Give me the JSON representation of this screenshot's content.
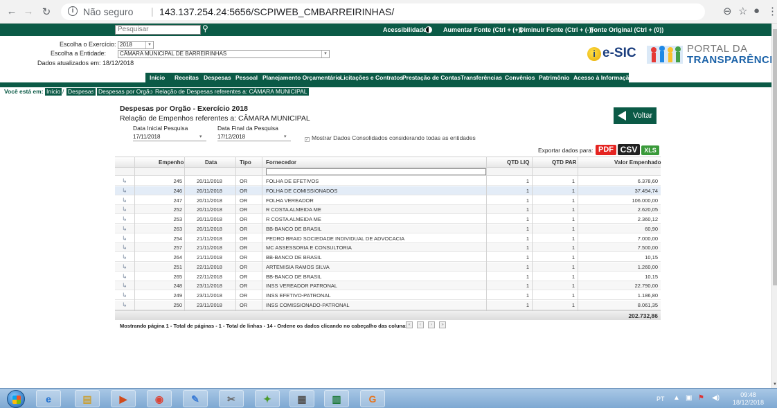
{
  "browser": {
    "security_label": "Não seguro",
    "separator": "|",
    "url": "143.137.254.24:5656/SCPIWEB_CMBARREIRINHAS/",
    "back_icon": "arrow-left-icon",
    "forward_icon": "arrow-right-icon",
    "reload_icon": "reload-icon"
  },
  "topbar": {
    "search_placeholder": "Pesquisar",
    "acessibilidade": "Acessibilidade:",
    "aumentar": "Aumentar Fonte (Ctrl + (+))",
    "diminuir": "Diminuir Fonte (Ctrl + (-))",
    "original": "Fonte Original (Ctrl + (0))"
  },
  "filters": {
    "exercicio_label": "Escolha o Exercício:",
    "exercicio_value": "2018",
    "entidade_label": "Escolha a Entidade:",
    "entidade_value": "CÂMARA MUNICIPAL DE BARREIRINHAS",
    "updated": "Dados atualizados em: 18/12/2018"
  },
  "logos": {
    "esic": "e-SIC",
    "esic_mark": "i",
    "portal_line1": "PORTAL DA",
    "portal_line2": "TRANSPARÊNCIA"
  },
  "menu": [
    "Início",
    "Receitas",
    "Despesas",
    "Pessoal",
    "Planejamento Orçamentário",
    "Licitações e Contratos",
    "Prestação de Contas",
    "Transferências",
    "Convênios",
    "Patrimônio",
    "Acesso à Informação"
  ],
  "breadcrumb": {
    "lead": "Você está em:",
    "items": [
      "Início",
      "Despesas",
      "Despesas por Orgão",
      "Relação de Despesas referentes a: CÂMARA MUNICIPAL"
    ],
    "sep": "/"
  },
  "page": {
    "title": "Despesas por Orgão - Exercício 2018",
    "subtitle": "Relação de Empenhos referentes a: CÂMARA MUNICIPAL",
    "voltar": "Voltar",
    "data_inicial_label": "Data Inicial Pesquisa",
    "data_inicial": "17/11/2018",
    "data_final_label": "Data Final da Pesquisa",
    "data_final": "17/12/2018",
    "consolidados": "Mostrar Dados Consolidados considerando todas as entidades",
    "export_label": "Exportar dados para:",
    "pdf": "PDF",
    "csv": "CSV",
    "xls": "XLS"
  },
  "table": {
    "headers": {
      "empenho": "Empenho",
      "data": "Data",
      "tipo": "Tipo",
      "fornecedor": "Fornecedor",
      "qtd_liq": "QTD LIQ",
      "qtd_par": "QTD PAR",
      "valor": "Valor Empenhado"
    },
    "rows": [
      {
        "empenho": "245",
        "data": "20/11/2018",
        "tipo": "OR",
        "fornecedor": "FOLHA DE EFETIVOS",
        "liq": "1",
        "par": "1",
        "valor": "6.378,60"
      },
      {
        "empenho": "246",
        "data": "20/11/2018",
        "tipo": "OR",
        "fornecedor": "FOLHA DE COMISSIONADOS",
        "liq": "1",
        "par": "1",
        "valor": "37.494,74"
      },
      {
        "empenho": "247",
        "data": "20/11/2018",
        "tipo": "OR",
        "fornecedor": "FOLHA VEREADOR",
        "liq": "1",
        "par": "1",
        "valor": "106.000,00"
      },
      {
        "empenho": "252",
        "data": "20/11/2018",
        "tipo": "OR",
        "fornecedor": "R COSTA ALMEIDA ME",
        "liq": "1",
        "par": "1",
        "valor": "2.620,05"
      },
      {
        "empenho": "253",
        "data": "20/11/2018",
        "tipo": "OR",
        "fornecedor": "R COSTA ALMEIDA ME",
        "liq": "1",
        "par": "1",
        "valor": "2.360,12"
      },
      {
        "empenho": "263",
        "data": "20/11/2018",
        "tipo": "OR",
        "fornecedor": "BB-BANCO DE BRASIL",
        "liq": "1",
        "par": "1",
        "valor": "60,90"
      },
      {
        "empenho": "254",
        "data": "21/11/2018",
        "tipo": "OR",
        "fornecedor": "PEDRO BRAID SOCIEDADE INDIVIDUAL DE ADVOCACIA",
        "liq": "1",
        "par": "1",
        "valor": "7.000,00"
      },
      {
        "empenho": "257",
        "data": "21/11/2018",
        "tipo": "OR",
        "fornecedor": "MC ASSESSORIA E CONSULTORIA",
        "liq": "1",
        "par": "1",
        "valor": "7.500,00"
      },
      {
        "empenho": "264",
        "data": "21/11/2018",
        "tipo": "OR",
        "fornecedor": "BB-BANCO DE BRASIL",
        "liq": "1",
        "par": "1",
        "valor": "10,15"
      },
      {
        "empenho": "251",
        "data": "22/11/2018",
        "tipo": "OR",
        "fornecedor": "ARTEMISIA RAMOS SILVA",
        "liq": "1",
        "par": "1",
        "valor": "1.260,00"
      },
      {
        "empenho": "265",
        "data": "22/11/2018",
        "tipo": "OR",
        "fornecedor": "BB-BANCO DE BRASIL",
        "liq": "1",
        "par": "1",
        "valor": "10,15"
      },
      {
        "empenho": "248",
        "data": "23/11/2018",
        "tipo": "OR",
        "fornecedor": "INSS VEREADOR PATRONAL",
        "liq": "1",
        "par": "1",
        "valor": "22.790,00"
      },
      {
        "empenho": "249",
        "data": "23/11/2018",
        "tipo": "OR",
        "fornecedor": "INSS EFETIVO-PATRONAL",
        "liq": "1",
        "par": "1",
        "valor": "1.186,80"
      },
      {
        "empenho": "250",
        "data": "23/11/2018",
        "tipo": "OR",
        "fornecedor": "INSS COMISSIONADO-PATRONAL",
        "liq": "1",
        "par": "1",
        "valor": "8.061,35"
      }
    ],
    "total": "202.732,86"
  },
  "pager": {
    "text": "Mostrando página 1 - Total de páginas - 1 - Total de linhas - 14 - Ordene os dados clicando no cabeçalho das colunas."
  },
  "taskbar": {
    "lang": "PT",
    "time": "09:48",
    "date": "18/12/2018"
  }
}
